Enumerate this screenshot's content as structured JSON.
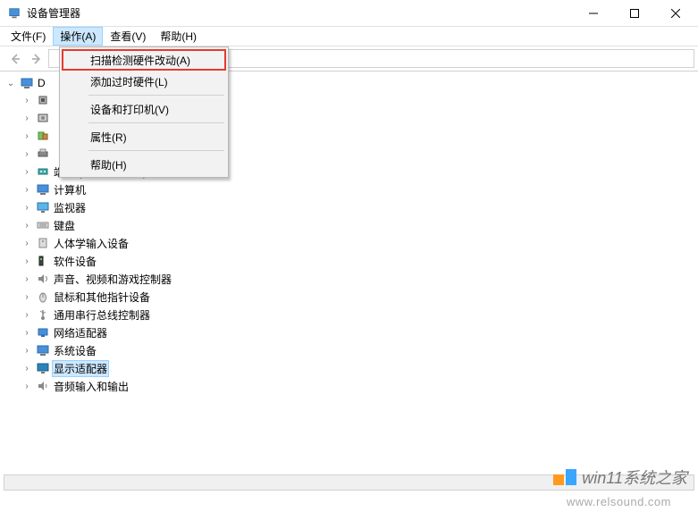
{
  "window": {
    "title": "设备管理器"
  },
  "controls": {
    "minimize": "—",
    "maximize": "□",
    "close": "✕"
  },
  "menubar": {
    "items": [
      {
        "label": "文件(F)"
      },
      {
        "label": "操作(A)"
      },
      {
        "label": "查看(V)"
      },
      {
        "label": "帮助(H)"
      }
    ],
    "active_index": 1
  },
  "dropdown": {
    "items": [
      {
        "label": "扫描检测硬件改动(A)",
        "highlight": true
      },
      {
        "label": "添加过时硬件(L)"
      },
      {
        "label": "设备和打印机(V)"
      },
      {
        "label": "属性(R)"
      },
      {
        "label": "帮助(H)"
      }
    ],
    "separators_after": [
      1,
      2,
      3
    ]
  },
  "toolbar": {
    "back_icon": "arrow-left-icon",
    "forward_icon": "arrow-right-icon"
  },
  "tree": {
    "root_label": "D",
    "expanded": true,
    "nodes": [
      {
        "icon": "cpu-icon",
        "label": ""
      },
      {
        "icon": "disk-icon",
        "label": ""
      },
      {
        "icon": "devices-icon",
        "label": ""
      },
      {
        "icon": "printer-icon",
        "label": ""
      },
      {
        "icon": "port-icon",
        "label": "端口 (COM 和 LPT)"
      },
      {
        "icon": "computer-icon",
        "label": "计算机"
      },
      {
        "icon": "monitor-icon",
        "label": "监视器"
      },
      {
        "icon": "keyboard-icon",
        "label": "键盘"
      },
      {
        "icon": "hid-icon",
        "label": "人体学输入设备"
      },
      {
        "icon": "software-icon",
        "label": "软件设备"
      },
      {
        "icon": "sound-icon",
        "label": "声音、视频和游戏控制器"
      },
      {
        "icon": "mouse-icon",
        "label": "鼠标和其他指针设备"
      },
      {
        "icon": "usb-icon",
        "label": "通用串行总线控制器"
      },
      {
        "icon": "network-icon",
        "label": "网络适配器"
      },
      {
        "icon": "system-icon",
        "label": "系统设备"
      },
      {
        "icon": "display-icon",
        "label": "显示适配器",
        "selected": true
      },
      {
        "icon": "audio-icon",
        "label": "音频输入和输出"
      }
    ]
  },
  "watermark": {
    "text": "win11系统之家",
    "site": "www.relsound.com"
  }
}
